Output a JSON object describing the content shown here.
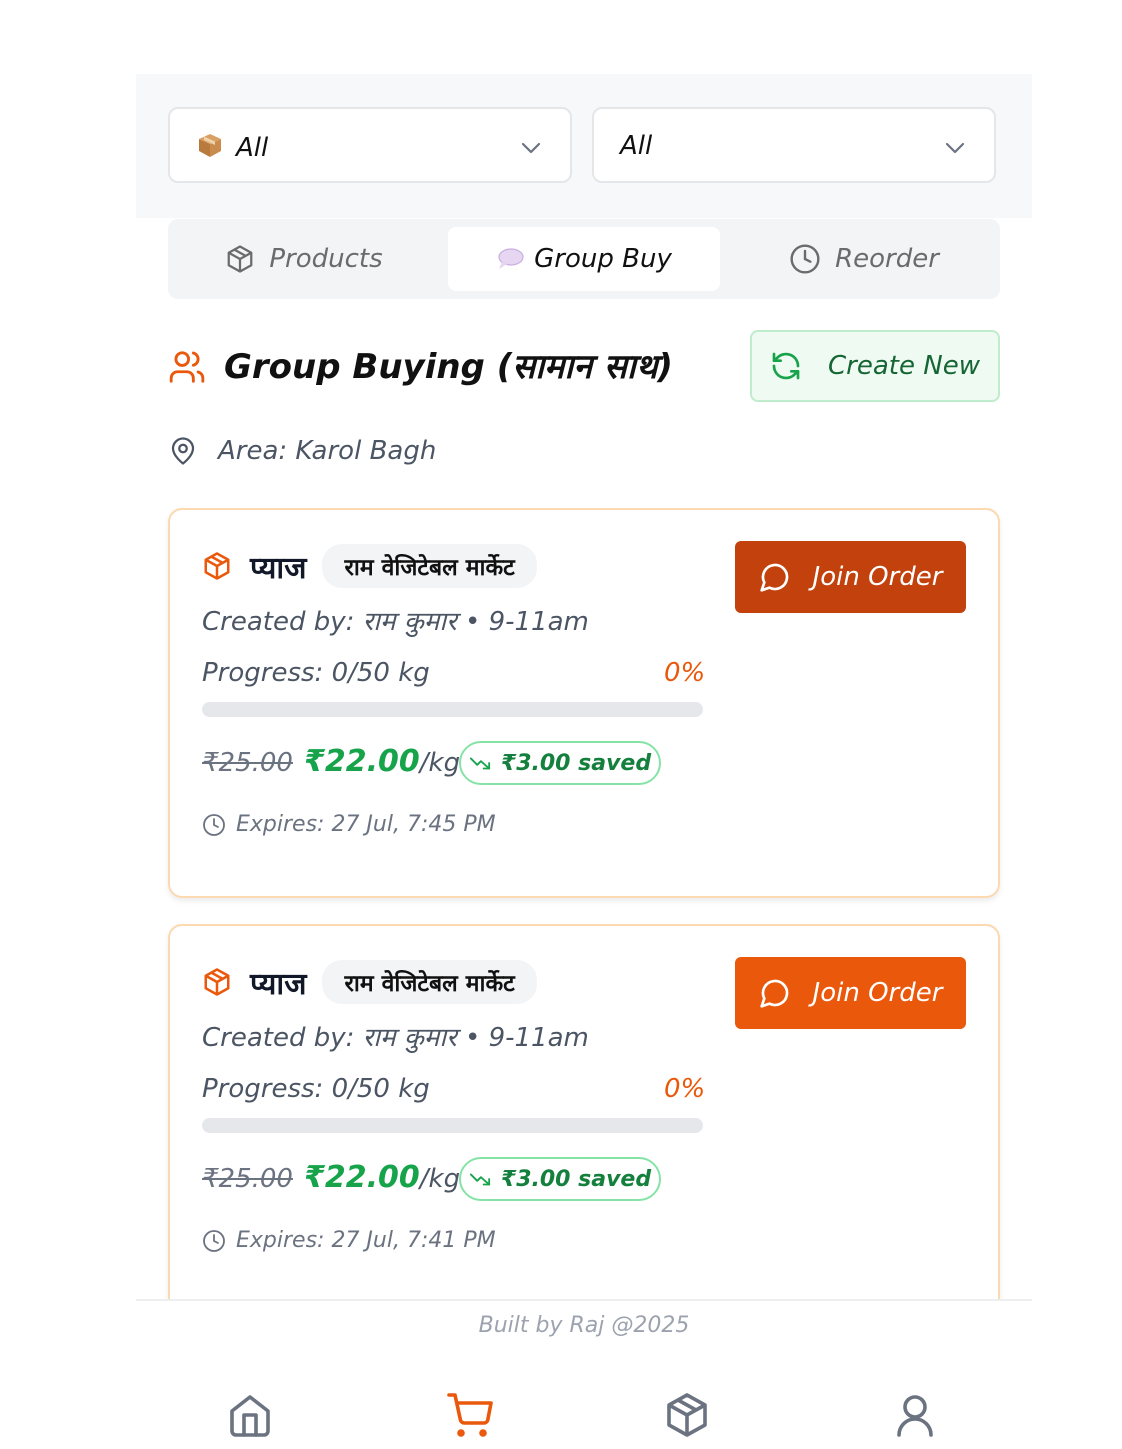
{
  "filters": {
    "category": {
      "value": "All",
      "icon": "package-emoji-icon"
    },
    "market": {
      "value": "All"
    }
  },
  "tabs": [
    {
      "label": "Products",
      "icon": "box-icon",
      "active": false
    },
    {
      "label": "Group Buy",
      "icon": "speech-bubble-icon",
      "active": true
    },
    {
      "label": "Reorder",
      "icon": "clock-icon",
      "active": false
    }
  ],
  "section": {
    "title": "Group Buying (सामान साथ)",
    "create_label": "Create New",
    "area_label": "Area: Karol Bagh"
  },
  "orders": [
    {
      "product": "प्याज",
      "vendor": "राम वेजिटेबल मार्केट",
      "creator": "Created by: राम कुमार • 9-11am",
      "progress_label": "Progress: 0/50 kg",
      "progress_pct": "0%",
      "progress_fraction": 0,
      "old_price": "₹25.00",
      "new_price": "₹22.00",
      "unit": "/kg",
      "saved": "₹3.00 saved",
      "expires": "Expires: 27 Jul, 7:45 PM",
      "join_label": "Join Order",
      "join_color": "#c2410c"
    },
    {
      "product": "प्याज",
      "vendor": "राम वेजिटेबल मार्केट",
      "creator": "Created by: राम कुमार • 9-11am",
      "progress_label": "Progress: 0/50 kg",
      "progress_pct": "0%",
      "progress_fraction": 0,
      "old_price": "₹25.00",
      "new_price": "₹22.00",
      "unit": "/kg",
      "saved": "₹3.00 saved",
      "expires": "Expires: 27 Jul, 7:41 PM",
      "join_label": "Join Order",
      "join_color": "#ea580c"
    }
  ],
  "footer": {
    "text": "Built by Raj @2025"
  },
  "bottom_nav": [
    {
      "icon": "home-icon",
      "active": false
    },
    {
      "icon": "cart-icon",
      "active": true
    },
    {
      "icon": "box-icon",
      "active": false
    },
    {
      "icon": "user-icon",
      "active": false
    }
  ],
  "colors": {
    "accent": "#ea580c",
    "green": "#16a34a"
  }
}
